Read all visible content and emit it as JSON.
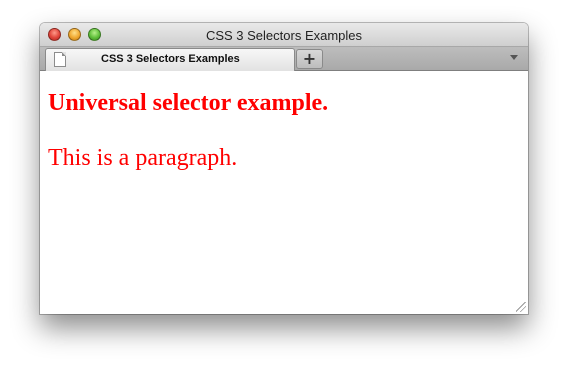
{
  "window": {
    "title": "CSS 3 Selectors Examples"
  },
  "tabs": [
    {
      "label": "CSS 3 Selectors Examples",
      "icon": "page-icon"
    }
  ],
  "tabbar": {
    "new_tab_label": "+",
    "menu_icon": "chevron-down-icon"
  },
  "page": {
    "heading": "Universal selector example.",
    "paragraph": "This is a paragraph.",
    "text_color": "#ff0000"
  }
}
